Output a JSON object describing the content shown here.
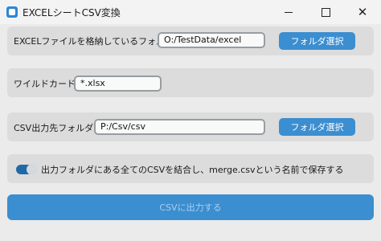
{
  "window": {
    "title": "EXCELシートCSV変換",
    "minimize_icon": "minimize-icon",
    "maximize_icon": "maximize-icon",
    "close_icon": "close-icon",
    "close_glyph": "✕"
  },
  "excel_folder": {
    "label": "EXCELファイルを格納しているフォルダ",
    "value": "O:/TestData/excel",
    "button_label": "フォルダ選択"
  },
  "wildcard": {
    "label": "ワイルドカード",
    "value": "*.xlsx"
  },
  "csv_folder": {
    "label": "CSV出力先フォルダ",
    "value": "P:/Csv/csv",
    "button_label": "フォルダ選択"
  },
  "merge_option": {
    "label": "出力フォルダにある全てのCSVを結合し、merge.csvという名前で保存する",
    "enabled": true
  },
  "output_button": {
    "label": "CSVに出力する"
  },
  "colors": {
    "accent": "#3b8ed0",
    "panel": "#dcdcdc",
    "background": "#ebebeb"
  }
}
